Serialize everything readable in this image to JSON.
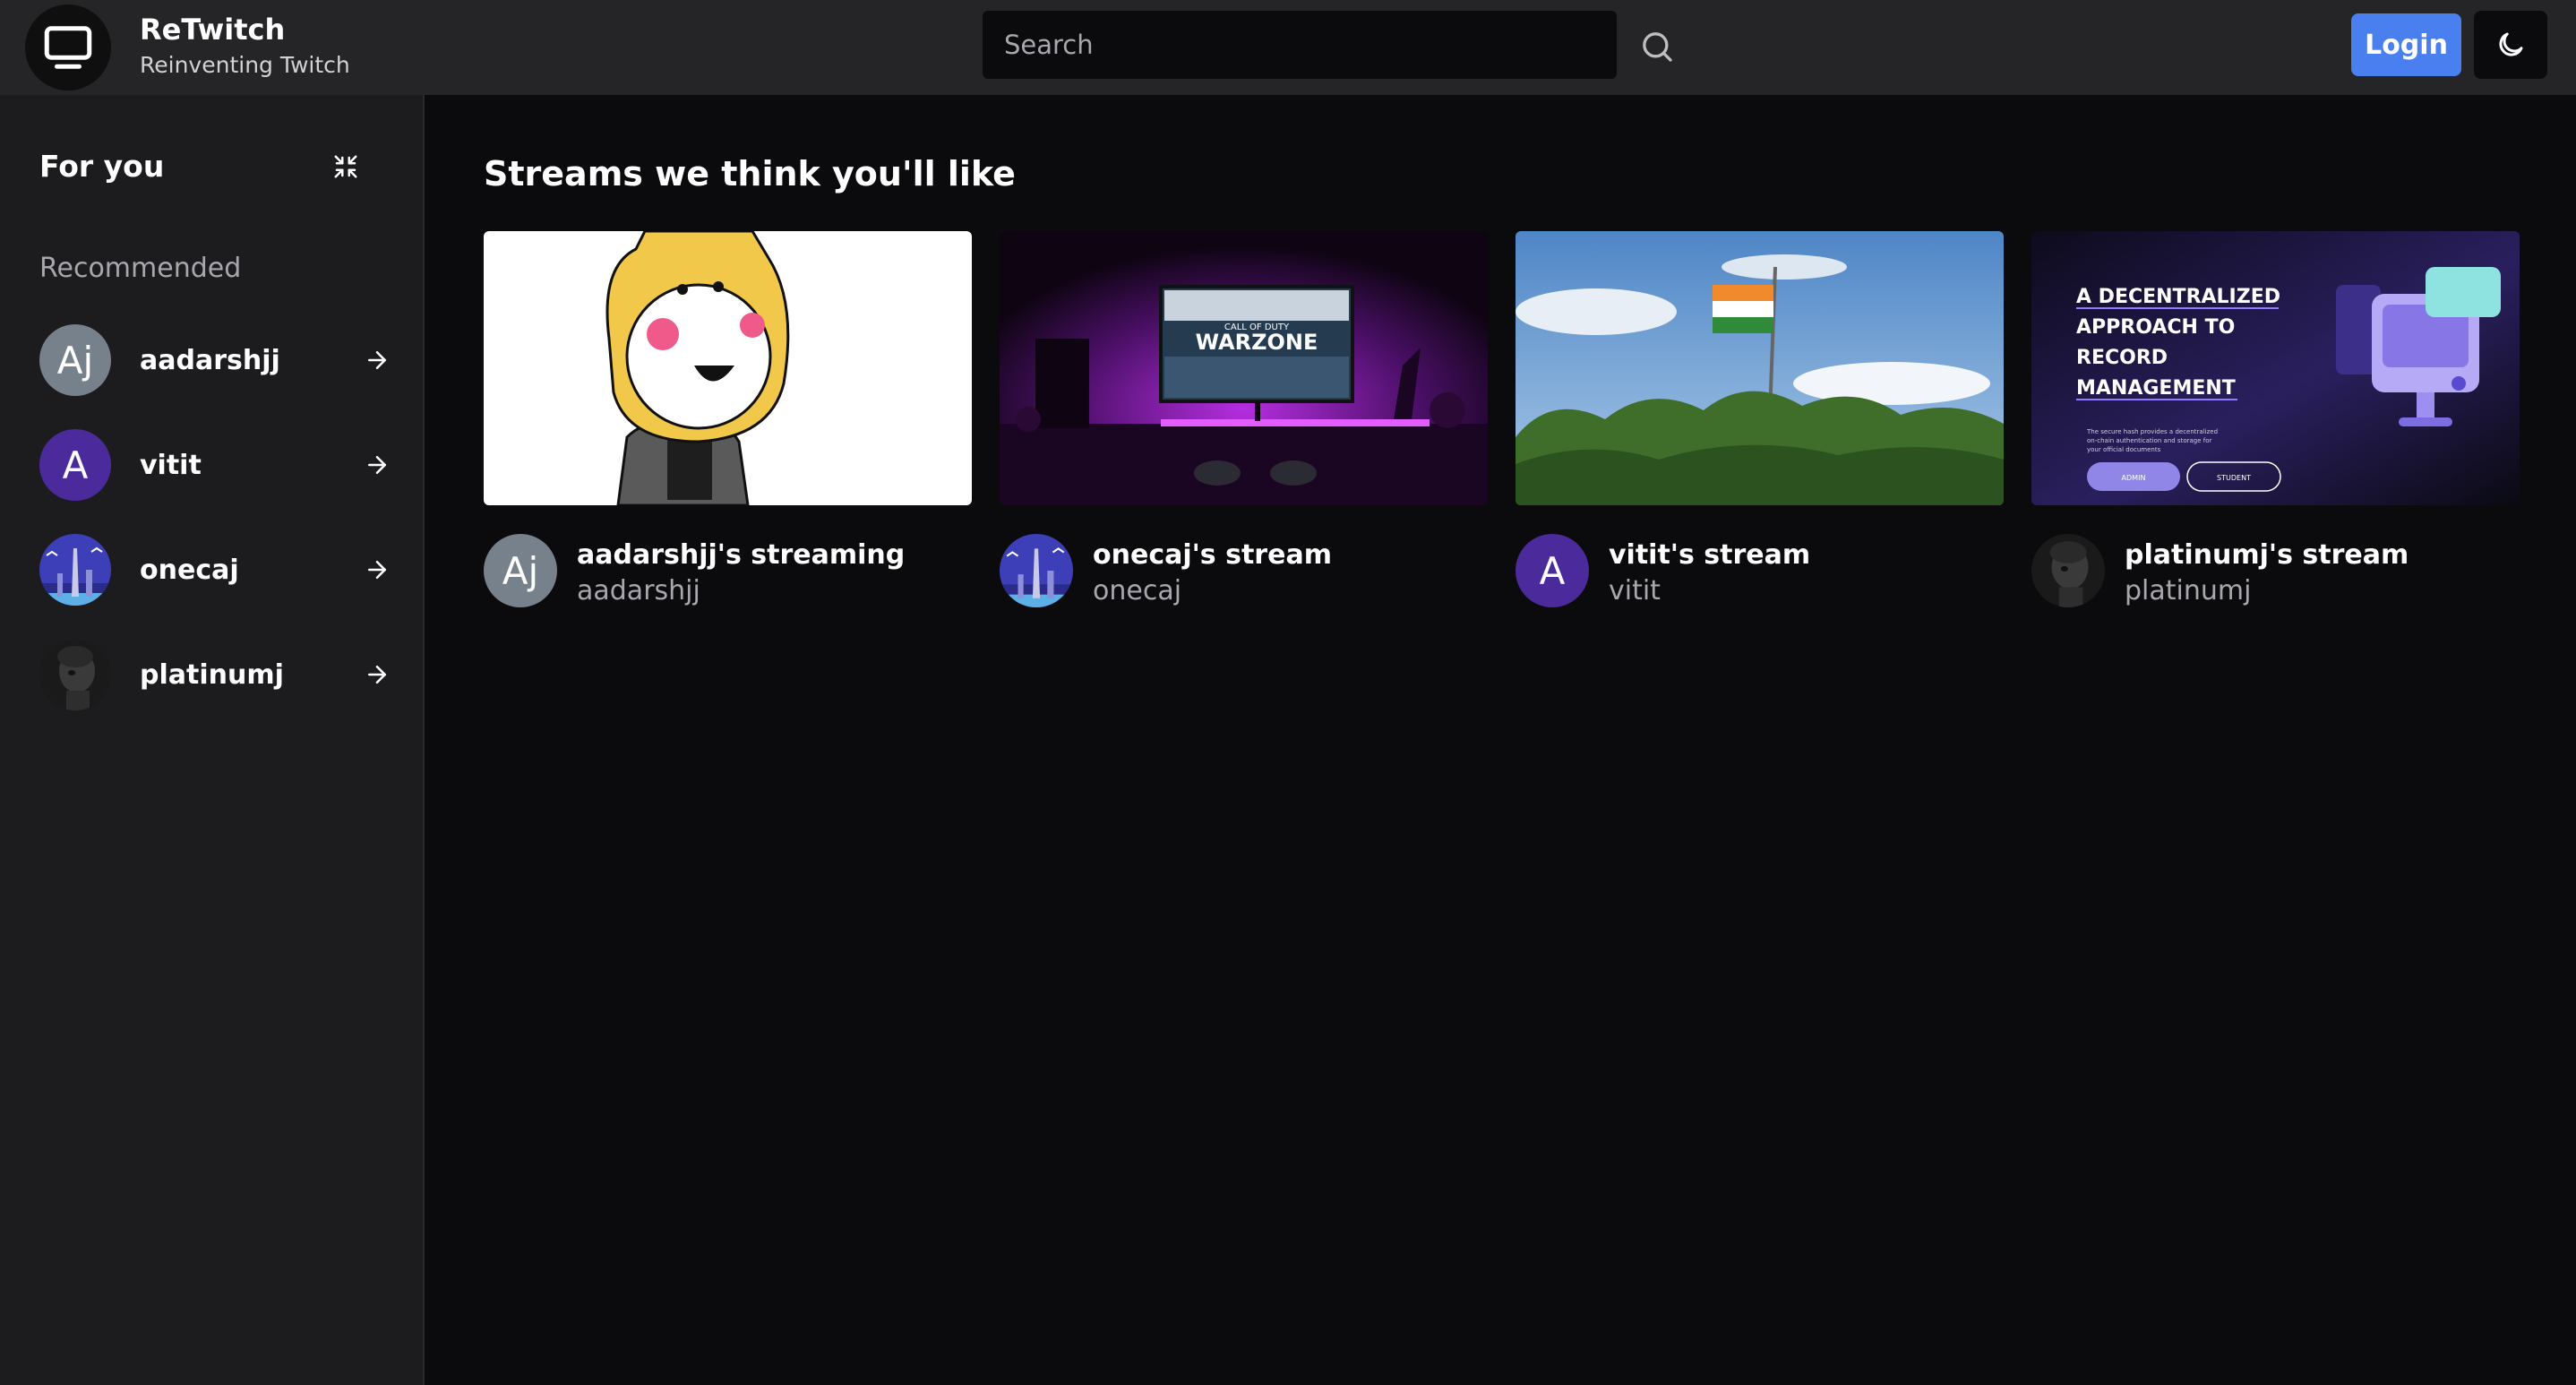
{
  "app": {
    "name": "ReTwitch",
    "tagline": "Reinventing Twitch"
  },
  "header": {
    "search_placeholder": "Search",
    "login_label": "Login",
    "icons": {
      "logo": "tv-icon",
      "search": "search-icon",
      "theme": "moon-icon"
    }
  },
  "sidebar": {
    "title": "For you",
    "section_label": "Recommended",
    "items": [
      {
        "name": "aadarshjj",
        "avatar_text": "Aj"
      },
      {
        "name": "vitit",
        "avatar_text": "A"
      },
      {
        "name": "onecaj"
      },
      {
        "name": "platinumj"
      }
    ]
  },
  "main": {
    "section_title": "Streams we think you'll like",
    "cards": [
      {
        "title": "aadarshjj's streaming",
        "streamer": "aadarshjj",
        "avatar_text": "Aj"
      },
      {
        "title": "onecaj's stream",
        "streamer": "onecaj",
        "thumb_text": [
          "CALL OF DUTY",
          "WARZONE"
        ]
      },
      {
        "title": "vitit's stream",
        "streamer": "vitit",
        "avatar_text": "A"
      },
      {
        "title": "platinumj's stream",
        "streamer": "platinumj",
        "thumb_text": [
          "A DECENTRALIZED",
          "APPROACH TO",
          "RECORD",
          "MANAGEMENT",
          "The secure hash provides a decentralized",
          "on-chain authentication and storage for",
          "your official documents",
          "ADMIN",
          "STUDENT"
        ]
      }
    ]
  },
  "colors": {
    "accent": "#4a7ff0",
    "sidebar_bg": "#1c1c1f",
    "header_bg": "#252528",
    "page_bg": "#0b0b0d"
  }
}
